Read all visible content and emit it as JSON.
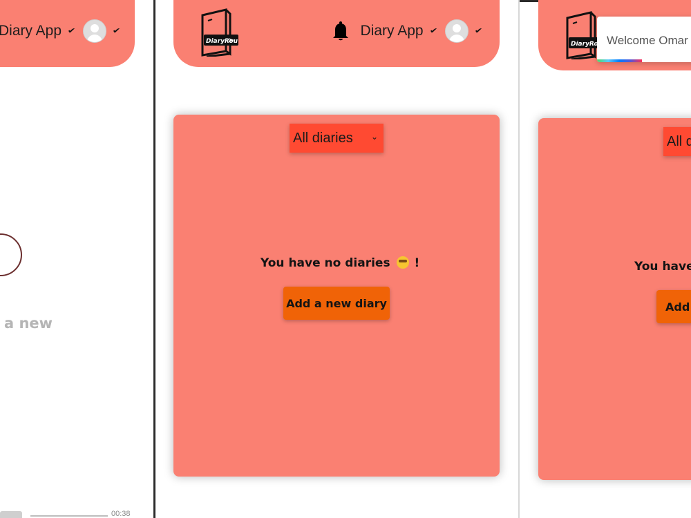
{
  "left_panel": {
    "header": {
      "app_label": "Diary App"
    },
    "partial_text": "a new",
    "video_time": "00:38"
  },
  "middle_panel": {
    "header": {
      "logo_text": "DiaryRou",
      "app_label": "Diary App"
    },
    "filter": {
      "selected": "All diaries"
    },
    "empty_state": {
      "message_before_emoji": "You have no diaries",
      "message_after_emoji": "!",
      "emoji": "grinning-face-with-sweat-icon"
    },
    "add_button_label": "Add a new diary"
  },
  "right_panel": {
    "header": {
      "logo_text": "DiaryRou"
    },
    "toast": {
      "text": "Welcome Omar"
    },
    "filter": {
      "selected_partial": "All d"
    },
    "empty_state": {
      "message_partial": "You have"
    },
    "add_button_partial": "Add"
  },
  "colors": {
    "header_bg": "#fa8072",
    "card_bg": "#fa8072",
    "select_bg": "#ff4a32",
    "button_bg": "#f06307"
  }
}
